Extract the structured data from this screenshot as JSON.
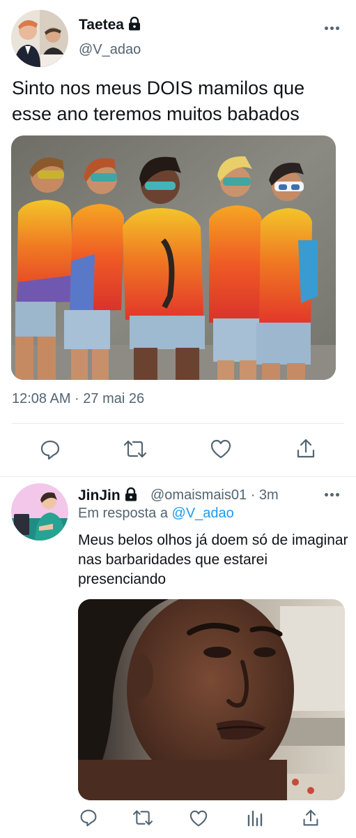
{
  "main_tweet": {
    "display_name": "Taetea",
    "handle": "@V_adao",
    "text": "Sinto nos meus DOIS mamilos que esse ano teremos muitos babados",
    "timestamp": "12:08 AM · 27 mai 26",
    "icons": {
      "lock": "lock-icon",
      "more": "more-horizontal-icon",
      "reply": "reply-icon",
      "retweet": "retweet-icon",
      "like": "heart-icon",
      "share": "share-icon"
    }
  },
  "reply_tweet": {
    "display_name": "JinJin",
    "handle": "@omaismais01",
    "time_ago": "· 3m",
    "reply_prefix": "Em resposta a",
    "reply_mention": "@V_adao",
    "text": "Meus belos olhos já doem só de imaginar nas barbaridades que estarei presenciando",
    "icons": {
      "lock": "lock-icon",
      "more": "more-horizontal-icon",
      "reply": "reply-icon",
      "retweet": "retweet-icon",
      "like": "heart-icon",
      "analytics": "analytics-icon",
      "share": "share-icon"
    }
  },
  "colors": {
    "text_primary": "#0f1419",
    "text_secondary": "#536471",
    "link": "#1d9bf0",
    "divider": "#e6e9ec"
  }
}
